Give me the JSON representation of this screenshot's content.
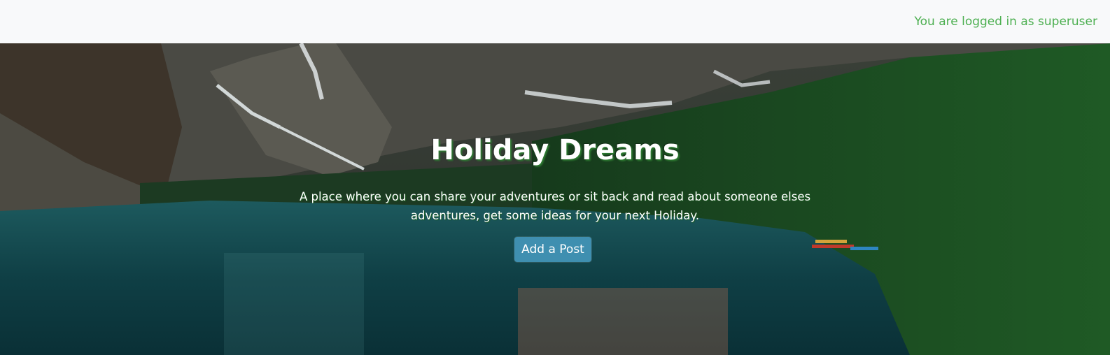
{
  "navbar": {
    "login_status": "You are logged in as superuser"
  },
  "hero": {
    "title": "Holiday Dreams",
    "subtitle": "A place where you can share your adventures or sit back and read about someone elses adventures, get some ideas for your next Holiday.",
    "add_post_label": "Add a Post"
  },
  "colors": {
    "navbar_bg": "#f8f9fa",
    "login_text": "#4caf50",
    "button_bg": "#3f8fb0"
  }
}
